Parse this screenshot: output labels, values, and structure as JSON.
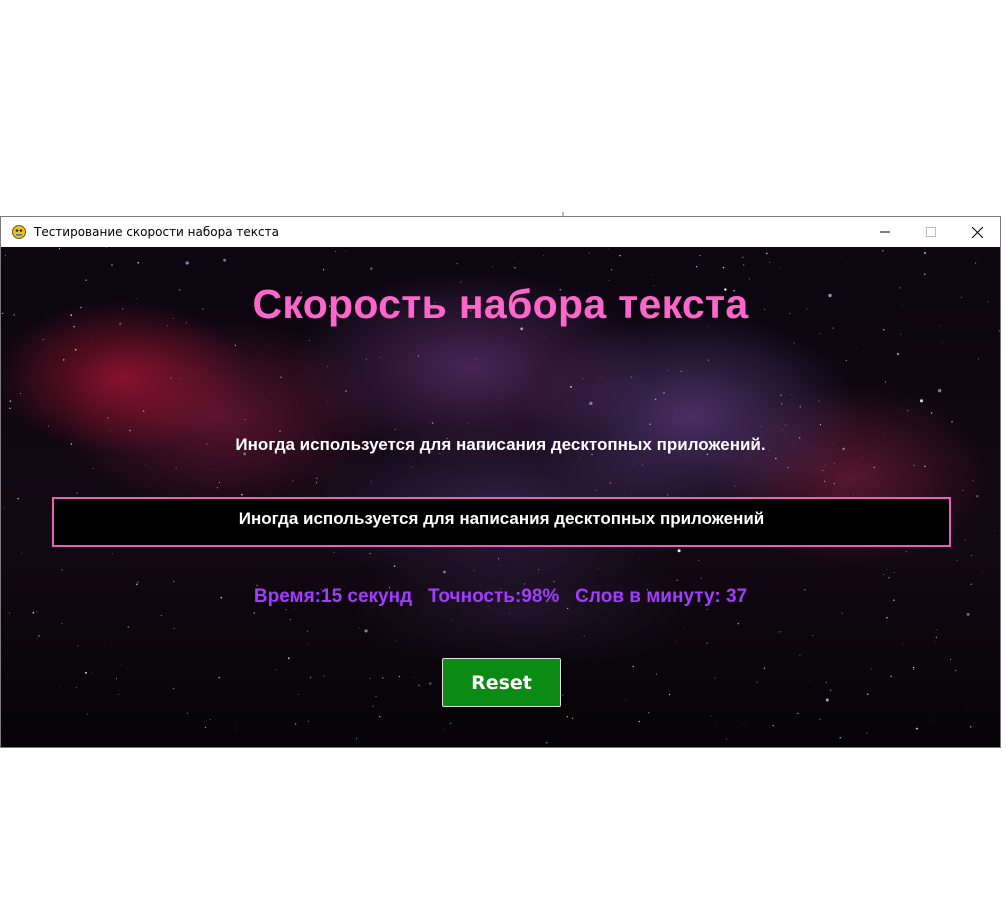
{
  "window": {
    "title": "Тестирование скорости набора текста",
    "icon": "pygame-snake-icon",
    "controls": [
      "minimize-icon",
      "maximize-icon",
      "close-icon"
    ]
  },
  "app": {
    "heading": "Скорость набора текста",
    "prompt_sentence": "Иногда используется для написания десктопных приложений.",
    "typed_input": "Иногда используется для написания десктопных приложений",
    "stats": {
      "time": "Время:15 секунд",
      "accuracy": "Точность:98%",
      "wpm": "Слов в минуту: 37"
    },
    "reset_label": "Reset"
  },
  "colors": {
    "heading": "#ff66cc",
    "stats": "#a23cff",
    "input_border": "#e860b8",
    "reset_bg": "#0b8a14"
  }
}
